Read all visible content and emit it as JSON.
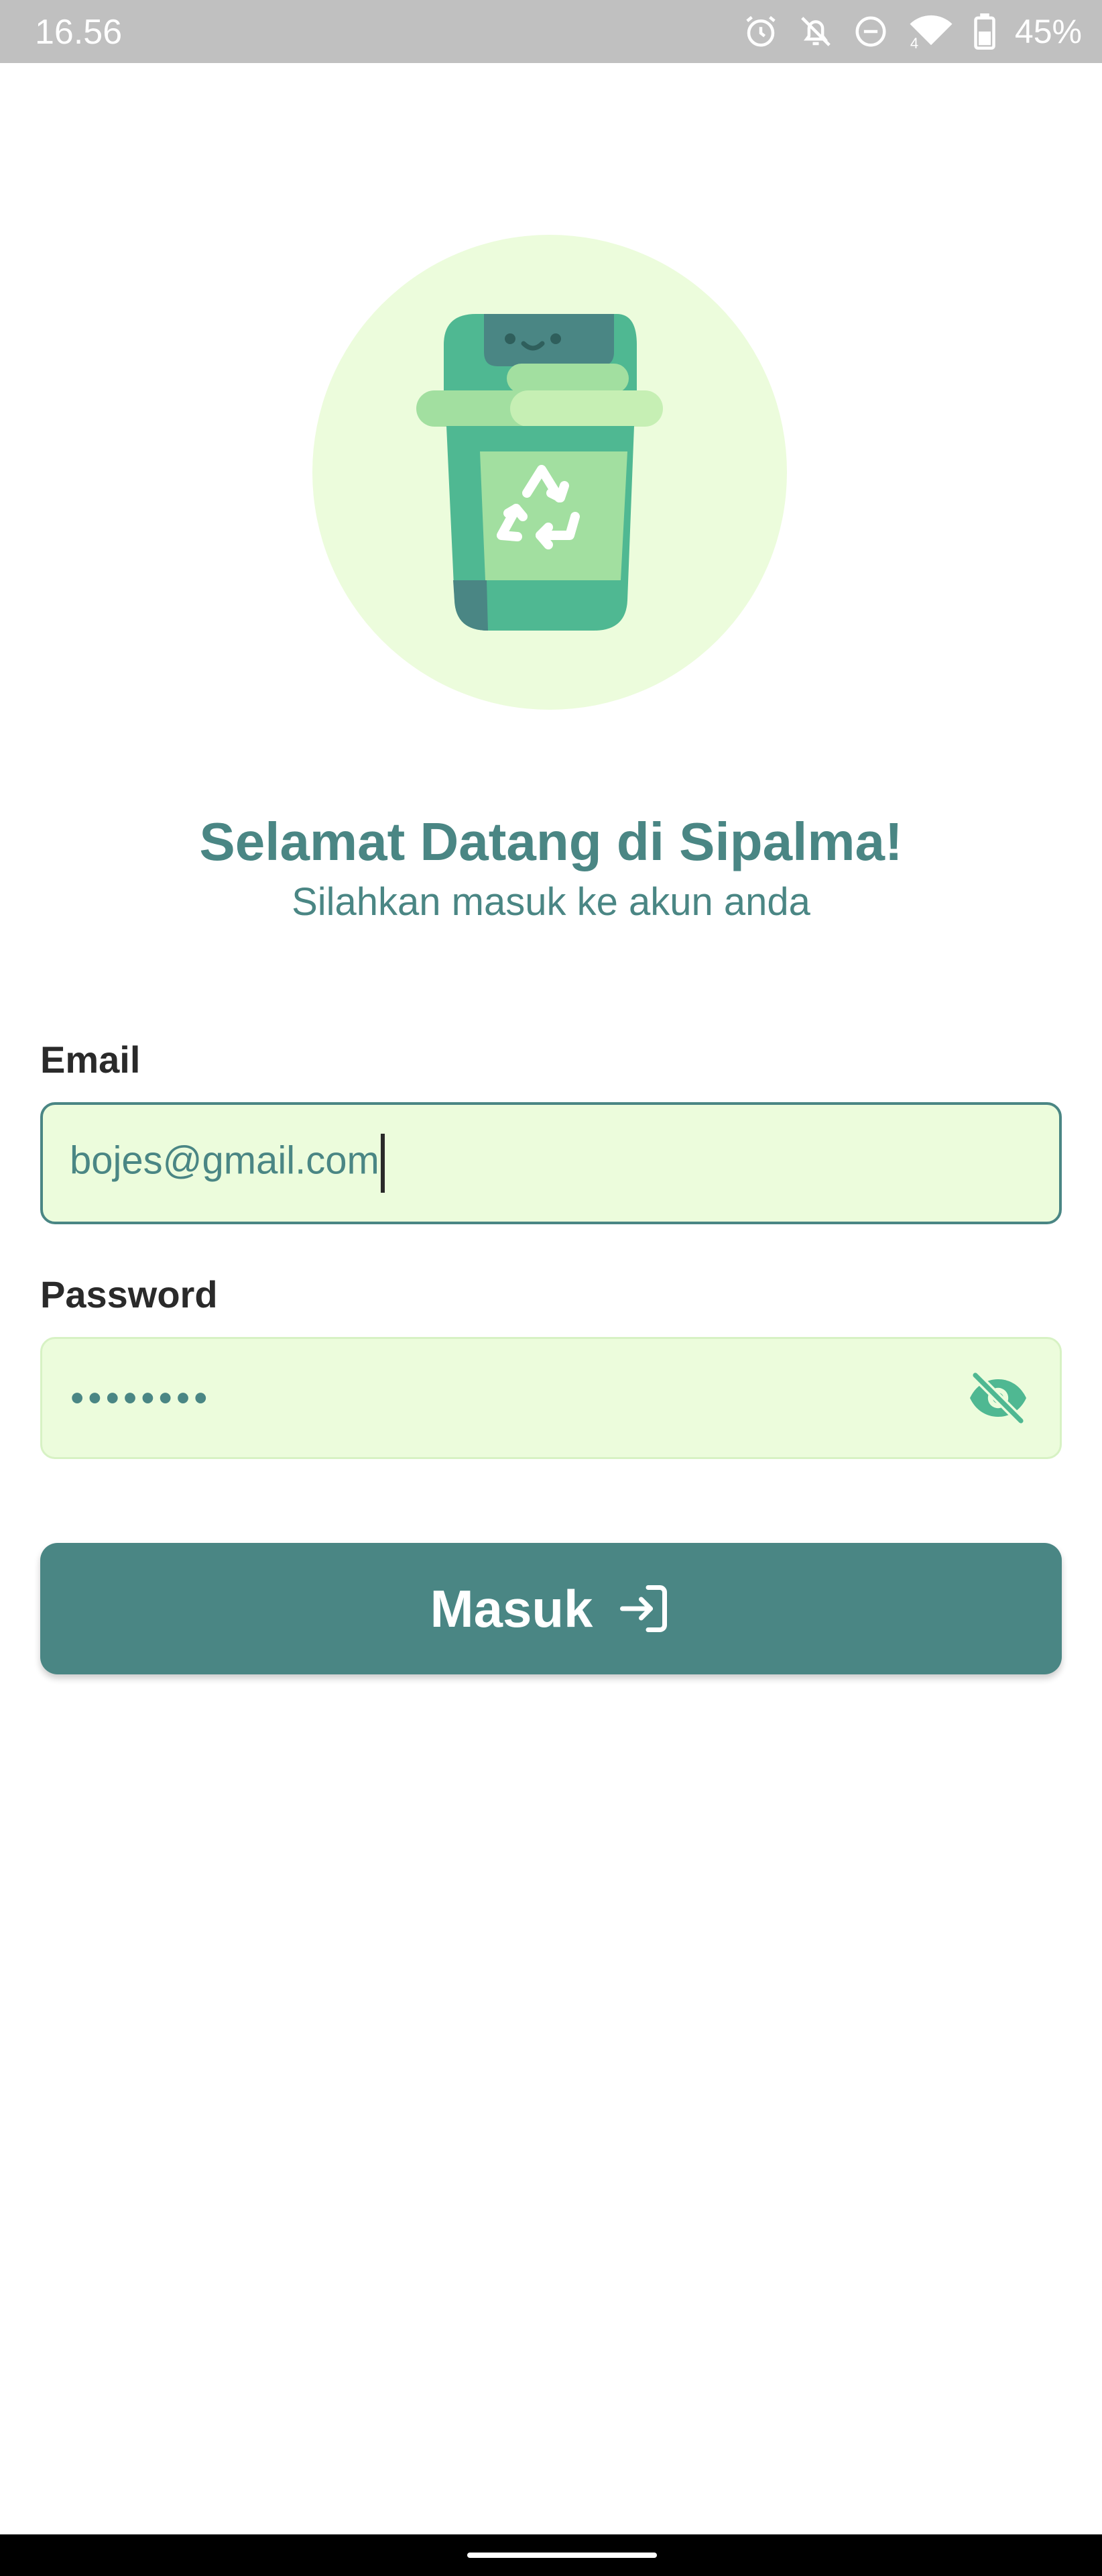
{
  "status_bar": {
    "time": "16.56",
    "battery_percent": "45%",
    "network_label": "4",
    "icons": [
      "alarm-icon",
      "notifications-off-icon",
      "do-not-disturb-icon",
      "wifi-icon",
      "battery-icon"
    ]
  },
  "hero": {
    "icon": "recycle-bin-icon",
    "background_color": "#ecfcdc"
  },
  "welcome": {
    "title": "Selamat Datang di Sipalma!",
    "subtitle": "Silahkan masuk ke akun anda"
  },
  "form": {
    "email_label": "Email",
    "email_value": "bojes@gmail.com",
    "password_label": "Password",
    "password_masked": "••••••••",
    "password_toggle_icon": "eye-off-icon",
    "submit_label": "Masuk",
    "submit_icon": "login-icon"
  },
  "colors": {
    "primary": "#4a8684",
    "field_background": "#ecfcdc",
    "accent_green": "#4fb892"
  }
}
